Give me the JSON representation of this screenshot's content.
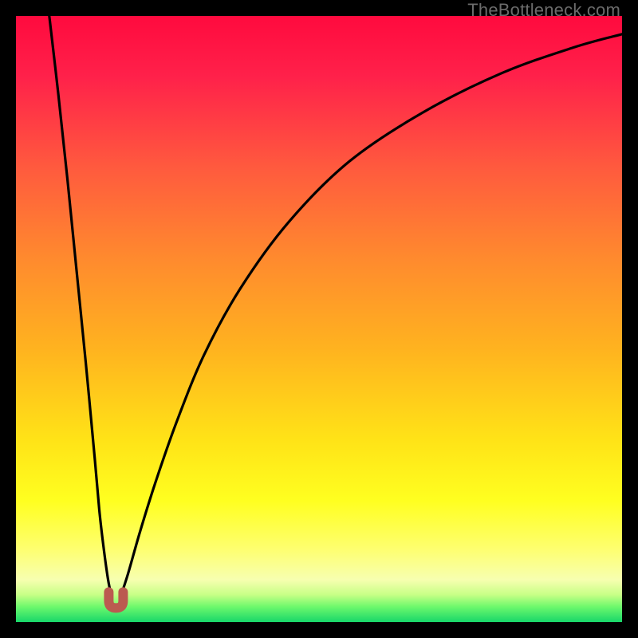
{
  "watermark": "TheBottleneck.com",
  "colors": {
    "frame": "#000000",
    "curve": "#000000",
    "accent_marker": "#bb5a50",
    "gradient_stops": [
      {
        "y": 0.0,
        "color": "#ff0a3e"
      },
      {
        "y": 0.1,
        "color": "#ff214a"
      },
      {
        "y": 0.25,
        "color": "#ff5a3e"
      },
      {
        "y": 0.4,
        "color": "#ff8a2e"
      },
      {
        "y": 0.55,
        "color": "#ffb31f"
      },
      {
        "y": 0.7,
        "color": "#ffe317"
      },
      {
        "y": 0.8,
        "color": "#ffff20"
      },
      {
        "y": 0.88,
        "color": "#feff70"
      },
      {
        "y": 0.93,
        "color": "#f7ffb0"
      },
      {
        "y": 0.955,
        "color": "#c7ff86"
      },
      {
        "y": 0.975,
        "color": "#6cf86c"
      },
      {
        "y": 1.0,
        "color": "#18d76a"
      }
    ]
  },
  "chart_data": {
    "type": "line",
    "title": "",
    "xlabel": "",
    "ylabel": "",
    "xlim": [
      0,
      1
    ],
    "ylim": [
      0,
      1
    ],
    "notes": "Two black curves on a vertical red→yellow→green gradient. Left curve descends steeply from top-left into a minimum near the bottom; right curve rises from the same minimum and asymptotically approaches the top-right. A small brownish U-shaped marker sits at the minimum.",
    "minimum_marker": {
      "x": 0.165,
      "y": 0.965
    },
    "series": [
      {
        "name": "left-branch",
        "x": [
          0.055,
          0.07,
          0.085,
          0.1,
          0.115,
          0.13,
          0.138,
          0.145,
          0.152,
          0.158
        ],
        "y": [
          0.0,
          0.13,
          0.27,
          0.42,
          0.57,
          0.73,
          0.82,
          0.88,
          0.93,
          0.96
        ]
      },
      {
        "name": "right-branch",
        "x": [
          0.172,
          0.185,
          0.205,
          0.23,
          0.265,
          0.31,
          0.37,
          0.45,
          0.55,
          0.67,
          0.8,
          0.92,
          1.0
        ],
        "y": [
          0.96,
          0.92,
          0.85,
          0.77,
          0.67,
          0.56,
          0.45,
          0.34,
          0.24,
          0.16,
          0.095,
          0.052,
          0.03
        ]
      }
    ]
  }
}
